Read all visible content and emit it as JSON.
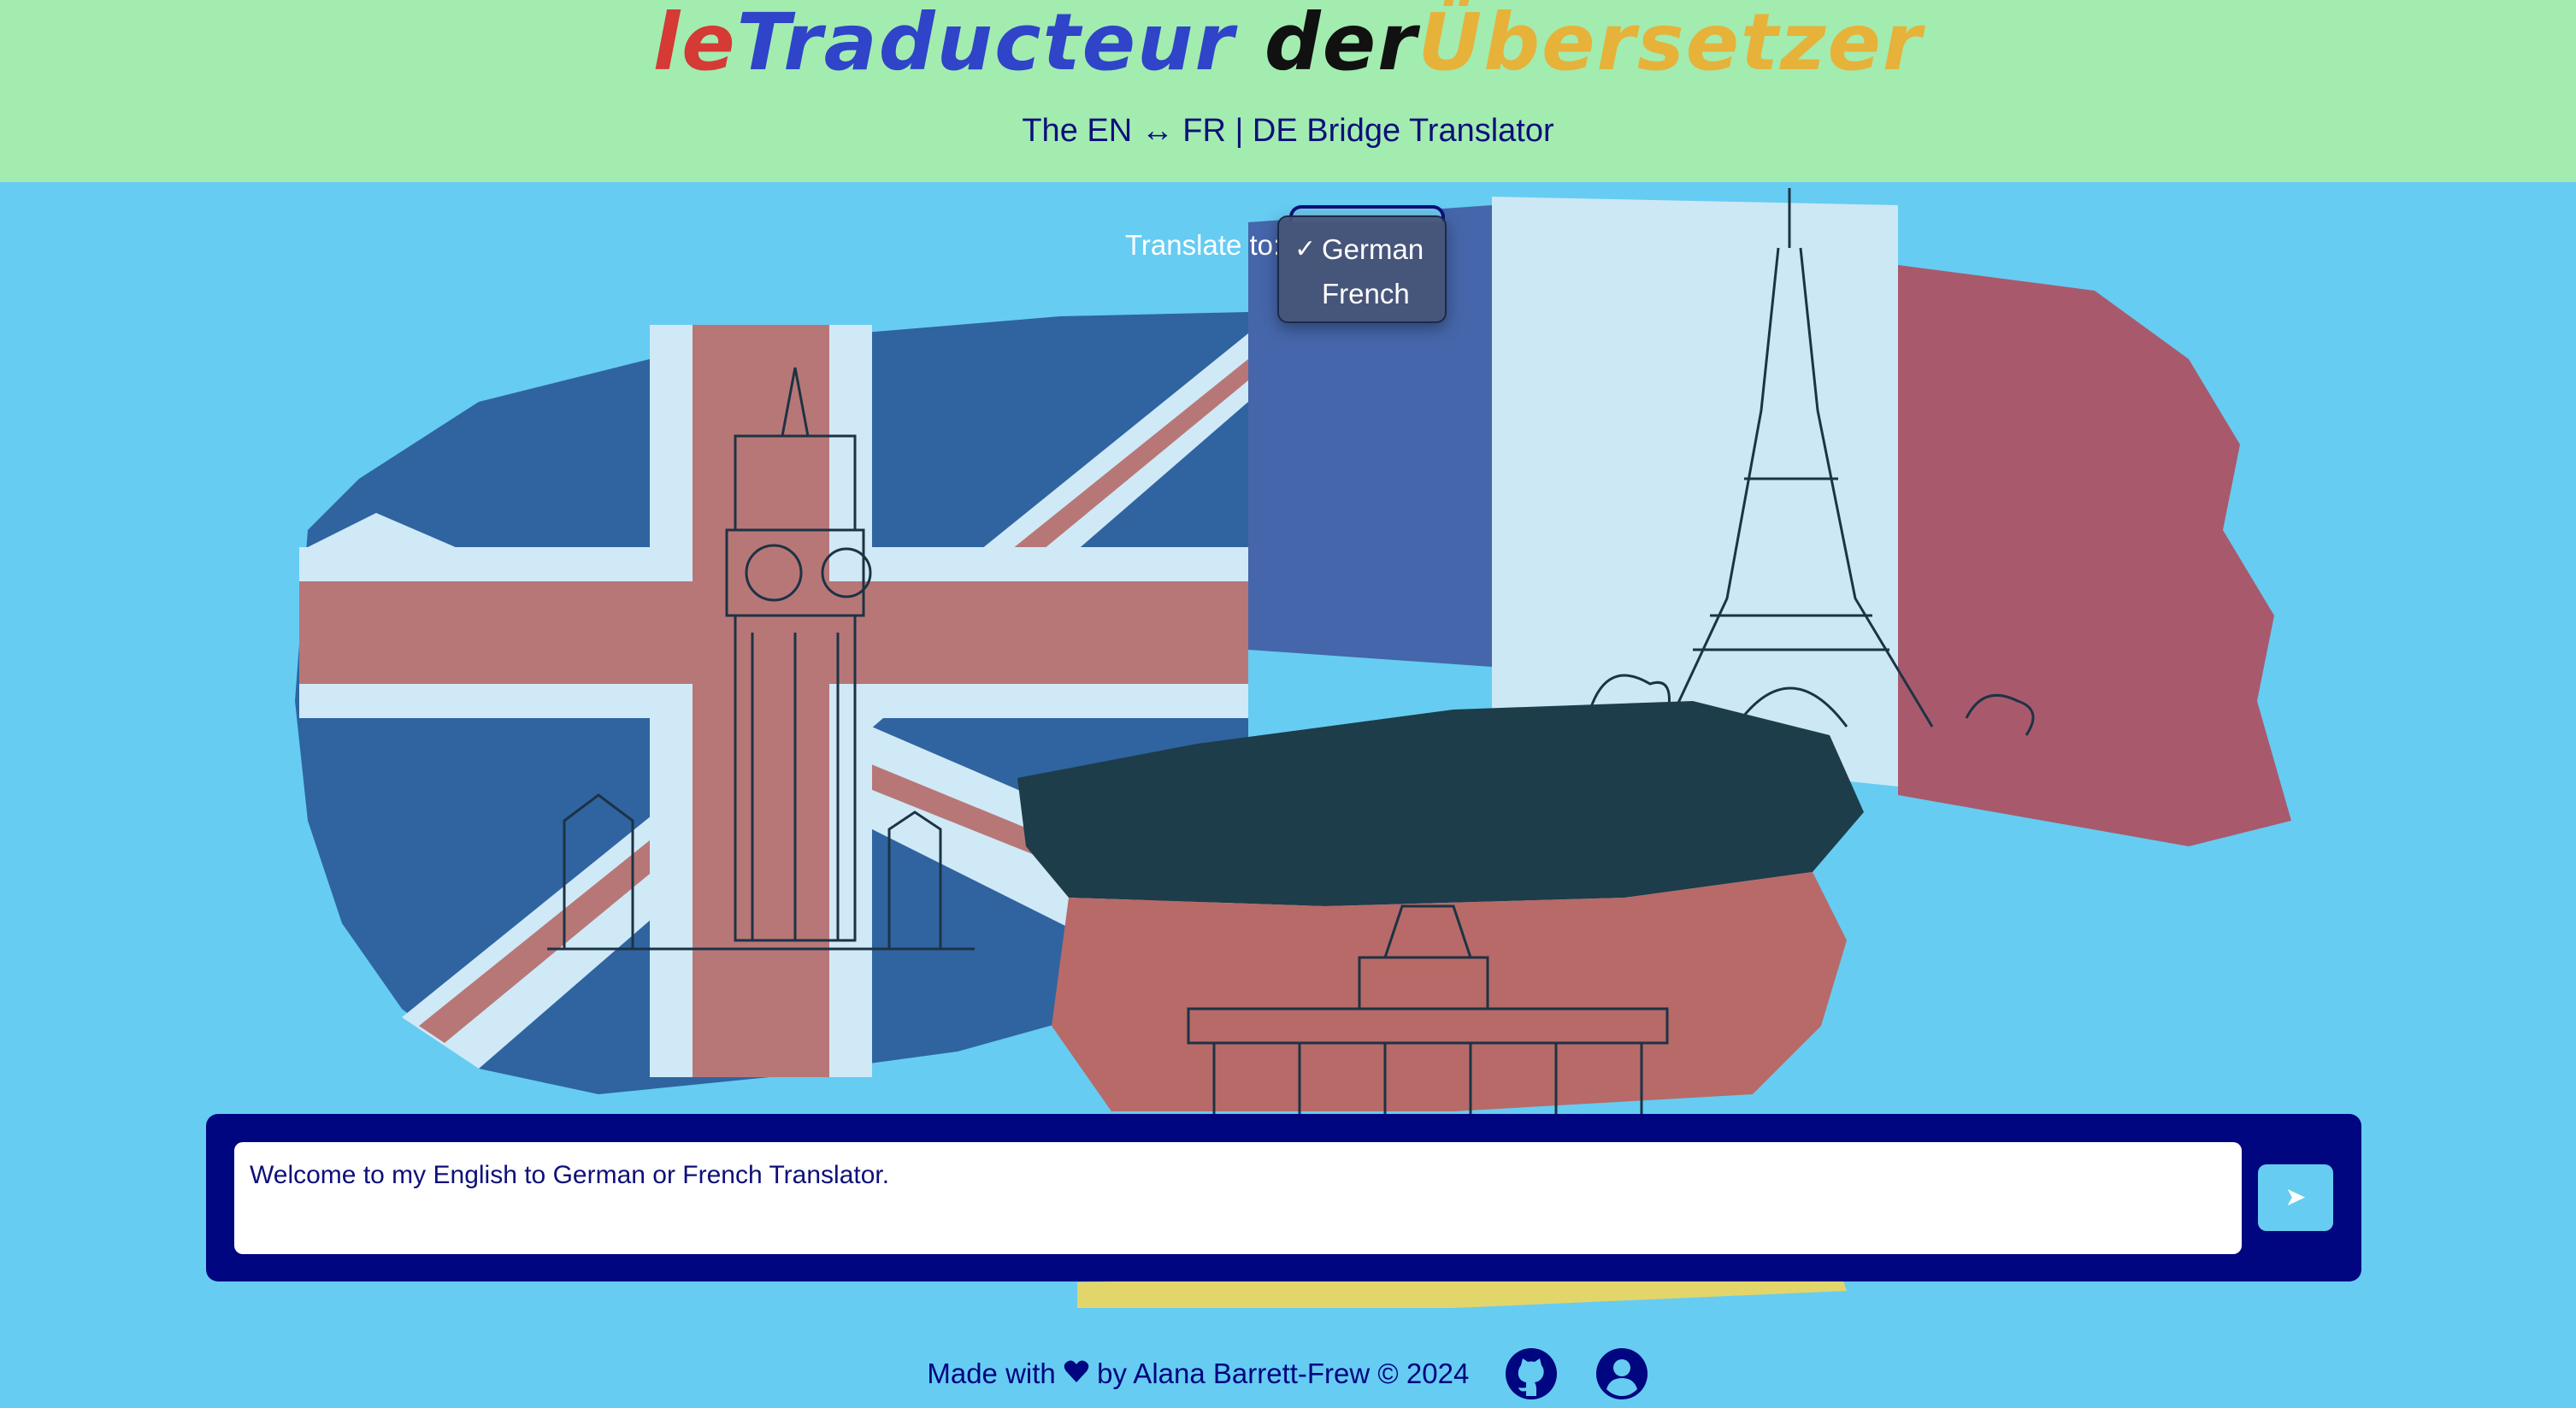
{
  "header": {
    "title_parts": [
      {
        "text": "le",
        "color": "#d53a35"
      },
      {
        "text": "Traducteur",
        "color": "#2f44c8"
      },
      {
        "text": " der",
        "color": "#111111"
      },
      {
        "text": "Übersetzer",
        "color": "#e6b23a"
      }
    ],
    "subtitle": "The EN ↔ FR | DE Bridge Translator"
  },
  "picker": {
    "label": "Translate to:",
    "options": [
      "German",
      "French"
    ],
    "selected": "German",
    "check_glyph": "✓"
  },
  "input": {
    "value": "Welcome to my English to German or French Translator.",
    "send_glyph": "➤"
  },
  "footer": {
    "made_with": "Made with",
    "by_line": "by Alana Barrett-Frew © 2024",
    "icons": [
      "heart-icon",
      "github-icon",
      "user-profile-icon"
    ]
  },
  "colors": {
    "header_bg": "#a2ecb0",
    "page_bg": "#66ccf2",
    "panel_bg": "#000580",
    "text_dark_blue": "#0d0f7a",
    "uk_blue": "#2f64a0",
    "uk_red": "#b87777",
    "fr_blue": "#4566aa",
    "fr_white": "#cce8f5",
    "fr_red": "#a85a6c",
    "de_black": "#1d3d4a",
    "de_red": "#b76a68",
    "de_gold": "#e2d66a"
  }
}
